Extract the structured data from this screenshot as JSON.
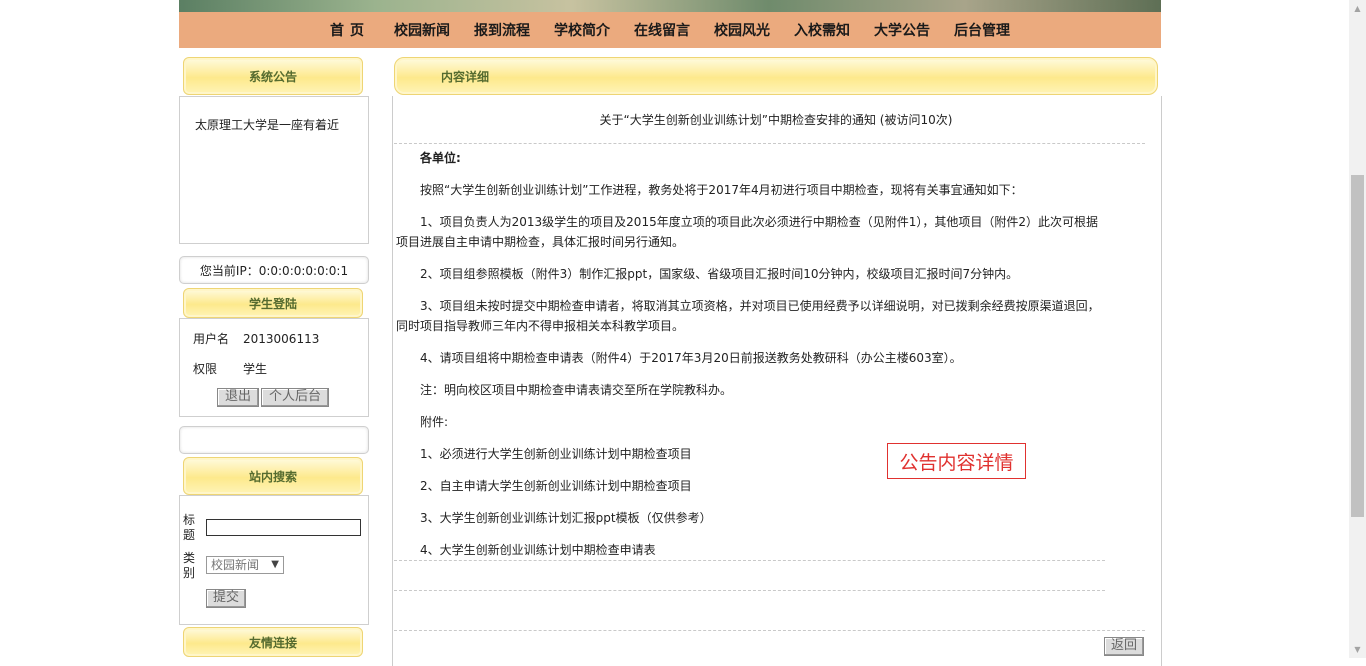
{
  "nav": {
    "items": [
      "首页",
      "校园新闻",
      "报到流程",
      "学校简介",
      "在线留言",
      "校园风光",
      "入校需知",
      "大学公告",
      "后台管理"
    ]
  },
  "sidebar": {
    "notice_title": "系统公告",
    "notice_text": "太原理工大学是一座有着近",
    "ip_text": "您当前IP：0:0:0:0:0:0:0:1",
    "login_title": "学生登陆",
    "username_label": "用户名",
    "username_value": "2013006113",
    "role_label": "权限",
    "role_value": "学生",
    "logout_button": "退出",
    "personal_button": "个人后台",
    "search_title": "站内搜索",
    "search_title_label": "标题",
    "search_category_label": "类别",
    "search_category_selected": "校园新闻",
    "search_submit": "提交",
    "links_title": "友情连接"
  },
  "main": {
    "tab_title": "内容详细",
    "article_title": "关于“大学生创新创业训练计划”中期检查安排的通知 (被访问10次)",
    "greeting": "各单位:",
    "paragraphs": [
      "按照“大学生创新创业训练计划”工作进程，教务处将于2017年4月初进行项目中期检查，现将有关事宜通知如下：",
      "1、项目负责人为2013级学生的项目及2015年度立项的项目此次必须进行中期检查（见附件1），其他项目（附件2）此次可根据项目进展自主申请中期检查，具体汇报时间另行通知。",
      "2、项目组参照模板（附件3）制作汇报ppt，国家级、省级项目汇报时间10分钟内，校级项目汇报时间7分钟内。",
      "3、项目组未按时提交中期检查申请者，将取消其立项资格，并对项目已使用经费予以详细说明，对已拨剩余经费按原渠道退回，同时项目指导教师三年内不得申报相关本科教学项目。",
      "4、请项目组将中期检查申请表（附件4）于2017年3月20日前报送教务处教研科（办公主楼603室）。",
      "注：明向校区项目中期检查申请表请交至所在学院教科办。",
      "附件:",
      "1、必须进行大学生创新创业训练计划中期检查项目",
      "2、自主申请大学生创新创业训练计划中期检查项目",
      "3、大学生创新创业训练计划汇报ppt模板（仅供参考）",
      "4、大学生创新创业训练计划中期检查申请表"
    ],
    "callout": "公告内容详情",
    "back_button": "返回"
  }
}
